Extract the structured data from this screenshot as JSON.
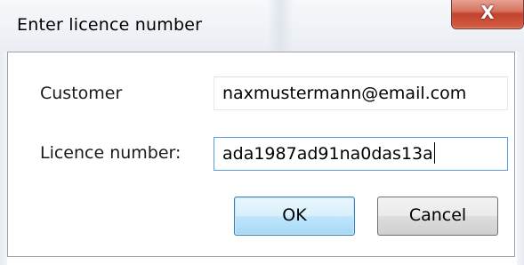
{
  "dialog": {
    "title": "Enter licence number",
    "close_glyph": "X",
    "close_icon": "close-icon"
  },
  "form": {
    "customer_label": "Customer",
    "customer_value": "naxmustermann@email.com",
    "licence_label": "Licence number:",
    "licence_value": "ada1987ad91na0das13a"
  },
  "buttons": {
    "ok_label": "OK",
    "cancel_label": "Cancel"
  },
  "colors": {
    "close_button": "#c2422e",
    "focus_border": "#569de5",
    "default_button_border": "#3c7fb1"
  }
}
